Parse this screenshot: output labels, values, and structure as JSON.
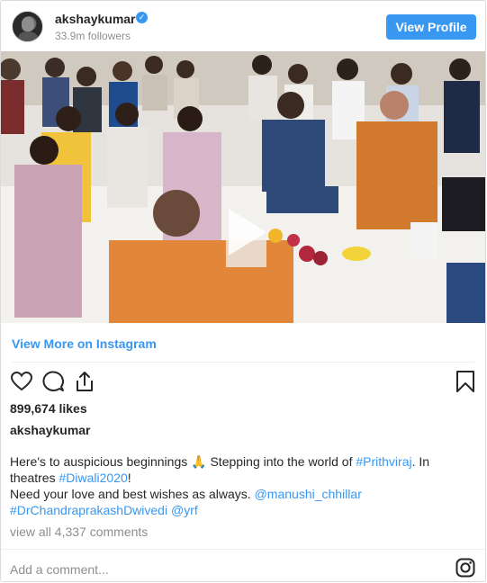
{
  "header": {
    "username": "akshaykumar",
    "verified_glyph": "✓",
    "followers": "33.9m followers",
    "view_profile": "View Profile"
  },
  "media": {
    "type": "video",
    "play_icon": "play-icon"
  },
  "view_more": "View More on Instagram",
  "actions": {
    "like_icon": "heart-icon",
    "comment_icon": "comment-icon",
    "share_icon": "share-icon",
    "save_icon": "bookmark-icon"
  },
  "likes": "899,674 likes",
  "author": "akshaykumar",
  "caption": {
    "line1_a": "Here's to auspicious beginnings ",
    "emoji": "🙏",
    "line1_b": " Stepping into the world of ",
    "hashtag_prithviraj": "#Prithviraj",
    "line1_c": ". In theatres ",
    "hashtag_diwali": "#Diwali2020",
    "line1_d": "!",
    "line2_a": "Need your love and best wishes as always. ",
    "mention_manushi": "@manushi_chhillar",
    "hashtag_director": "#DrChandraprakashDwivedi",
    "mention_yrf": "@yrf"
  },
  "comments_link": "view all 4,337 comments",
  "add_comment_placeholder": "Add a comment...",
  "colors": {
    "accent": "#3897f0",
    "text": "#262626",
    "muted": "#8e8e8e"
  }
}
